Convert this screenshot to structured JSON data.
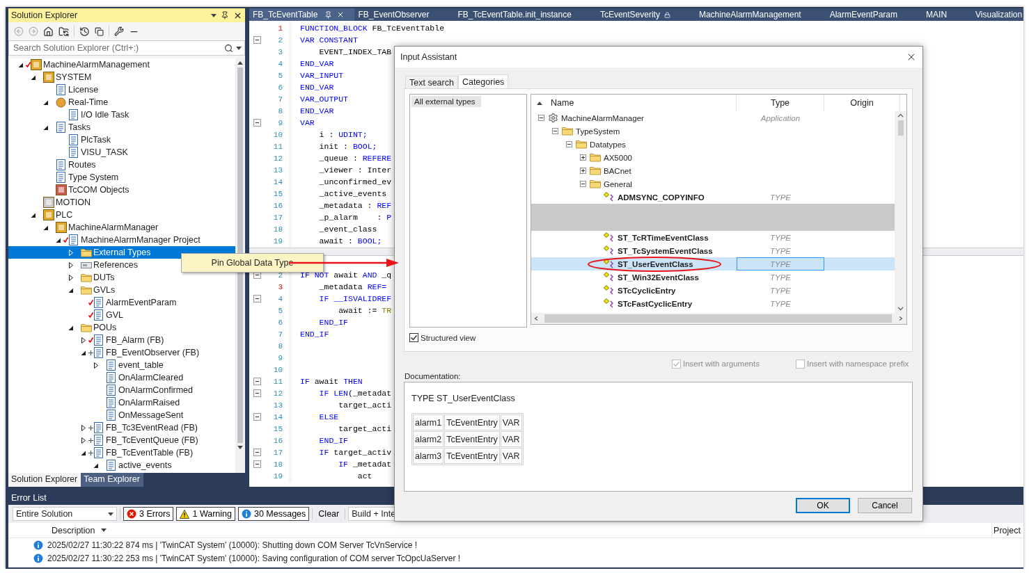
{
  "explorer": {
    "title": "Solution Explorer",
    "search": {
      "placeholder": "Search Solution Explorer (Ctrl+:)"
    },
    "tree": [
      {
        "label": "MachineAlarmManagement",
        "kind": "package",
        "checked_in": true,
        "expanded": true,
        "selected": false,
        "children": [
          {
            "label": "SYSTEM",
            "kind": "package",
            "expanded": true,
            "selected": false,
            "children": [
              {
                "label": "License",
                "kind": "document",
                "selected": false
              },
              {
                "label": "Real-Time",
                "kind": "sphere",
                "expanded": true,
                "selected": false,
                "children": [
                  {
                    "label": "I/O Idle Task",
                    "kind": "document",
                    "selected": false
                  }
                ]
              },
              {
                "label": "Tasks",
                "kind": "document",
                "expanded": true,
                "selected": false,
                "children": [
                  {
                    "label": "PlcTask",
                    "kind": "document",
                    "selected": false
                  },
                  {
                    "label": "VISU_TASK",
                    "kind": "document",
                    "selected": false
                  }
                ]
              },
              {
                "label": "Routes",
                "kind": "document",
                "selected": false
              },
              {
                "label": "Type System",
                "kind": "document",
                "selected": false
              },
              {
                "label": "TcCOM Objects",
                "kind": "component",
                "selected": false
              }
            ]
          },
          {
            "label": "MOTION",
            "kind": "motion",
            "selected": false
          },
          {
            "label": "PLC",
            "kind": "package",
            "expanded": true,
            "selected": false,
            "children": [
              {
                "label": "MachineAlarmManager",
                "kind": "package",
                "expanded": true,
                "selected": false,
                "children": [
                  {
                    "label": "MachineAlarmManager Project",
                    "kind": "document",
                    "checked_in": true,
                    "expanded": true,
                    "selected": false,
                    "children": [
                      {
                        "label": "External Types",
                        "kind": "folder",
                        "expanded": false,
                        "selected": true
                      },
                      {
                        "label": "References",
                        "kind": "drive",
                        "expanded": false,
                        "selected": false
                      },
                      {
                        "label": "DUTs",
                        "kind": "folder",
                        "expanded": false,
                        "selected": false
                      },
                      {
                        "label": "GVLs",
                        "kind": "folder",
                        "expanded": true,
                        "selected": false,
                        "children": [
                          {
                            "label": "AlarmEventParam",
                            "kind": "document",
                            "checked_in": true,
                            "selected": false
                          },
                          {
                            "label": "GVL",
                            "kind": "document",
                            "checked_in": true,
                            "selected": false
                          }
                        ]
                      },
                      {
                        "label": "POUs",
                        "kind": "folder",
                        "expanded": true,
                        "selected": false,
                        "children": [
                          {
                            "label": "FB_Alarm (FB)",
                            "kind": "document",
                            "checked_in": true,
                            "expanded": false,
                            "selected": false
                          },
                          {
                            "label": "FB_EventObserver (FB)",
                            "kind": "document",
                            "added": true,
                            "expanded": true,
                            "selected": false,
                            "children": [
                              {
                                "label": "event_table",
                                "kind": "document",
                                "expanded": false,
                                "selected": false
                              },
                              {
                                "label": "OnAlarmCleared",
                                "kind": "document",
                                "selected": false
                              },
                              {
                                "label": "OnAlarmConfirmed",
                                "kind": "document",
                                "selected": false
                              },
                              {
                                "label": "OnAlarmRaised",
                                "kind": "document",
                                "selected": false
                              },
                              {
                                "label": "OnMessageSent",
                                "kind": "document",
                                "selected": false
                              }
                            ]
                          },
                          {
                            "label": "FB_Tc3EventRead (FB)",
                            "kind": "document",
                            "added": true,
                            "expanded": false,
                            "selected": false
                          },
                          {
                            "label": "FB_TcEventQueue (FB)",
                            "kind": "document",
                            "added": true,
                            "expanded": false,
                            "selected": false
                          },
                          {
                            "label": "FB_TcEventTable (FB)",
                            "kind": "document",
                            "added": true,
                            "expanded": true,
                            "selected": false,
                            "children": [
                              {
                                "label": "active_events",
                                "kind": "document",
                                "expanded": true,
                                "selected": false
                              }
                            ]
                          }
                        ]
                      }
                    ]
                  }
                ]
              }
            ]
          }
        ]
      }
    ],
    "tabs": [
      {
        "label": "Solution Explorer",
        "selected": true
      },
      {
        "label": "Team Explorer",
        "selected": false
      }
    ]
  },
  "editor": {
    "tabs": [
      {
        "label": "FB_TcEventTable",
        "selected": true,
        "pinned": true,
        "locked": false
      },
      {
        "label": "FB_EventObserver",
        "selected": false,
        "pinned": false,
        "locked": false
      },
      {
        "label": "FB_TcEventTable.init_instance",
        "selected": false,
        "pinned": false,
        "locked": false
      },
      {
        "label": "TcEventSeverity",
        "selected": false,
        "pinned": false,
        "locked": true
      },
      {
        "label": "MachineAlarmManagement",
        "selected": false,
        "pinned": false,
        "locked": false
      },
      {
        "label": "AlarmEventParam",
        "selected": false,
        "pinned": false,
        "locked": false
      },
      {
        "label": "MAIN",
        "selected": false,
        "pinned": false,
        "locked": false
      },
      {
        "label": "Visualization",
        "selected": false,
        "pinned": false,
        "locked": false
      }
    ],
    "panes": [
      {
        "lines": [
          {
            "num": "1",
            "changed": true,
            "fold": false,
            "tokens": [
              {
                "text": "FUNCTION_BLOCK",
                "kind": "keyword"
              },
              {
                "text": " FB_TcEventTable",
                "kind": "plain"
              }
            ]
          },
          {
            "num": "2",
            "changed": false,
            "fold": true,
            "tokens": [
              {
                "text": "VAR CONSTANT",
                "kind": "keyword"
              }
            ]
          },
          {
            "num": "3",
            "changed": false,
            "fold": false,
            "tokens": [
              {
                "text": "    EVENT_INDEX_TAB",
                "kind": "plain"
              }
            ]
          },
          {
            "num": "4",
            "changed": false,
            "fold": false,
            "tokens": [
              {
                "text": "END_VAR",
                "kind": "keyword"
              }
            ]
          },
          {
            "num": "5",
            "changed": false,
            "fold": false,
            "tokens": [
              {
                "text": "VAR_INPUT",
                "kind": "keyword"
              }
            ]
          },
          {
            "num": "6",
            "changed": false,
            "fold": false,
            "tokens": [
              {
                "text": "END_VAR",
                "kind": "keyword"
              }
            ]
          },
          {
            "num": "7",
            "changed": false,
            "fold": false,
            "tokens": [
              {
                "text": "VAR_OUTPUT",
                "kind": "keyword"
              }
            ]
          },
          {
            "num": "8",
            "changed": false,
            "fold": false,
            "tokens": [
              {
                "text": "END_VAR",
                "kind": "keyword"
              }
            ]
          },
          {
            "num": "9",
            "changed": false,
            "fold": true,
            "tokens": [
              {
                "text": "VAR",
                "kind": "keyword"
              }
            ]
          },
          {
            "num": "10",
            "changed": false,
            "fold": false,
            "tokens": [
              {
                "text": "    i : ",
                "kind": "plain"
              },
              {
                "text": "UDINT;",
                "kind": "keyword"
              }
            ]
          },
          {
            "num": "11",
            "changed": false,
            "fold": false,
            "tokens": [
              {
                "text": "    init : ",
                "kind": "plain"
              },
              {
                "text": "BOOL;",
                "kind": "keyword"
              }
            ]
          },
          {
            "num": "12",
            "changed": false,
            "fold": false,
            "tokens": [
              {
                "text": "    _queue : ",
                "kind": "plain"
              },
              {
                "text": "REFERE",
                "kind": "keyword"
              }
            ]
          },
          {
            "num": "13",
            "changed": false,
            "fold": false,
            "tokens": [
              {
                "text": "    _viewer : Inter",
                "kind": "plain"
              }
            ]
          },
          {
            "num": "14",
            "changed": false,
            "fold": false,
            "tokens": [
              {
                "text": "    _unconfirmed_ev",
                "kind": "plain"
              }
            ]
          },
          {
            "num": "15",
            "changed": false,
            "fold": false,
            "tokens": [
              {
                "text": "    _active_events",
                "kind": "plain"
              }
            ]
          },
          {
            "num": "16",
            "changed": false,
            "fold": false,
            "tokens": [
              {
                "text": "    _metadata : ",
                "kind": "plain"
              },
              {
                "text": "REF",
                "kind": "keyword"
              }
            ]
          },
          {
            "num": "17",
            "changed": false,
            "fold": false,
            "tokens": [
              {
                "text": "    _p_alarm    : ",
                "kind": "plain"
              },
              {
                "text": "P",
                "kind": "keyword"
              }
            ]
          },
          {
            "num": "18",
            "changed": false,
            "fold": false,
            "tokens": [
              {
                "text": "    _event_class",
                "kind": "plain"
              }
            ]
          },
          {
            "num": "19",
            "changed": false,
            "fold": false,
            "tokens": [
              {
                "text": "    await : ",
                "kind": "plain"
              },
              {
                "text": "BOOL;",
                "kind": "keyword"
              }
            ]
          }
        ]
      },
      {
        "lines": [
          {
            "num": "2",
            "changed": false,
            "fold": true,
            "tokens": [
              {
                "text": "IF NOT",
                "kind": "keyword"
              },
              {
                "text": " await ",
                "kind": "plain"
              },
              {
                "text": "AND",
                "kind": "keyword"
              },
              {
                "text": " _q",
                "kind": "plain"
              }
            ]
          },
          {
            "num": "3",
            "changed": true,
            "fold": false,
            "tokens": [
              {
                "text": "    _metadata ",
                "kind": "plain"
              },
              {
                "text": "REF=",
                "kind": "keyword"
              }
            ]
          },
          {
            "num": "4",
            "changed": false,
            "fold": true,
            "tokens": [
              {
                "text": "    IF __ISVALIDREF",
                "kind": "keyword"
              }
            ]
          },
          {
            "num": "5",
            "changed": false,
            "fold": false,
            "tokens": [
              {
                "text": "        await := ",
                "kind": "plain"
              },
              {
                "text": "TR",
                "kind": "constant"
              }
            ]
          },
          {
            "num": "6",
            "changed": false,
            "fold": false,
            "tokens": [
              {
                "text": "    END_IF",
                "kind": "keyword"
              }
            ]
          },
          {
            "num": "7",
            "changed": false,
            "fold": false,
            "tokens": [
              {
                "text": "END_IF",
                "kind": "keyword"
              }
            ]
          },
          {
            "num": "8",
            "changed": false,
            "fold": false
          },
          {
            "num": "9",
            "changed": false,
            "fold": false
          },
          {
            "num": "10",
            "changed": false,
            "fold": false
          },
          {
            "num": "11",
            "changed": false,
            "fold": true,
            "tokens": [
              {
                "text": "IF",
                "kind": "keyword"
              },
              {
                "text": " await ",
                "kind": "plain"
              },
              {
                "text": "THEN",
                "kind": "keyword"
              }
            ]
          },
          {
            "num": "12",
            "changed": false,
            "fold": true,
            "tokens": [
              {
                "text": "    IF LEN",
                "kind": "keyword"
              },
              {
                "text": "(_metadat",
                "kind": "plain"
              }
            ]
          },
          {
            "num": "13",
            "changed": false,
            "fold": false,
            "tokens": [
              {
                "text": "        target_acti",
                "kind": "plain"
              }
            ]
          },
          {
            "num": "14",
            "changed": false,
            "fold": true,
            "tokens": [
              {
                "text": "    ELSE",
                "kind": "keyword"
              }
            ]
          },
          {
            "num": "15",
            "changed": false,
            "fold": false,
            "tokens": [
              {
                "text": "        target_acti",
                "kind": "plain"
              }
            ]
          },
          {
            "num": "16",
            "changed": false,
            "fold": false,
            "tokens": [
              {
                "text": "    END_IF",
                "kind": "keyword"
              }
            ]
          },
          {
            "num": "17",
            "changed": false,
            "fold": true,
            "tokens": [
              {
                "text": "    IF",
                "kind": "keyword"
              },
              {
                "text": " target_activ",
                "kind": "plain"
              }
            ]
          },
          {
            "num": "18",
            "changed": false,
            "fold": true,
            "tokens": [
              {
                "text": "        IF",
                "kind": "keyword"
              },
              {
                "text": " _metadat",
                "kind": "plain"
              }
            ]
          },
          {
            "num": "19",
            "changed": false,
            "fold": false,
            "tokens": [
              {
                "text": "            act",
                "kind": "plain"
              }
            ]
          }
        ]
      }
    ]
  },
  "tooltip": {
    "text": "Pin Global Data Type"
  },
  "dialog": {
    "title": "Input Assistant",
    "tabs": [
      {
        "label": "Text search",
        "selected": false
      },
      {
        "label": "Categories",
        "selected": true
      }
    ],
    "categories": [
      {
        "label": "All external types",
        "selected": true
      }
    ],
    "columns": [
      "Name",
      "Type",
      "Origin"
    ],
    "tree": [
      {
        "name": "MachineAlarmManager",
        "kind": "application",
        "type": "Application",
        "expanded": true,
        "selected": false,
        "children": [
          {
            "name": "TypeSystem",
            "kind": "folder",
            "expanded": true,
            "selected": false,
            "children": [
              {
                "name": "Datatypes",
                "kind": "folder",
                "expanded": true,
                "selected": false,
                "children": [
                  {
                    "name": "AX5000",
                    "kind": "folder",
                    "expanded": false,
                    "selected": false
                  },
                  {
                    "name": "BACnet",
                    "kind": "folder",
                    "expanded": false,
                    "selected": false
                  },
                  {
                    "name": "General",
                    "kind": "folder",
                    "expanded": true,
                    "selected": false,
                    "children": [
                      {
                        "name": "ADMSYNC_COPYINFO",
                        "kind": "datatype",
                        "type": "TYPE",
                        "selected": false
                      },
                      {
                        "kind": "redacted"
                      },
                      {
                        "name": "ST_TcRTimeEventClass",
                        "kind": "datatype",
                        "type": "TYPE",
                        "selected": false
                      },
                      {
                        "name": "ST_TcSystemEventClass",
                        "kind": "datatype",
                        "type": "TYPE",
                        "selected": false
                      },
                      {
                        "name": "ST_UserEventClass",
                        "kind": "datatype",
                        "type": "TYPE",
                        "selected": true
                      },
                      {
                        "name": "ST_Win32EventClass",
                        "kind": "datatype",
                        "type": "TYPE",
                        "selected": false
                      },
                      {
                        "name": "STcCyclicEntry",
                        "kind": "datatype",
                        "type": "TYPE",
                        "selected": false
                      },
                      {
                        "name": "STcFastCyclicEntry",
                        "kind": "datatype",
                        "type": "TYPE",
                        "selected": false
                      }
                    ]
                  }
                ]
              }
            ]
          }
        ]
      }
    ],
    "structured_view": {
      "label": "Structured view",
      "checked": true
    },
    "options": [
      {
        "label": "Insert with arguments",
        "checked": true,
        "disabled": true
      },
      {
        "label": "Insert with namespace prefix",
        "checked": false,
        "disabled": true
      }
    ],
    "documentation": {
      "label": "Documentation:",
      "heading": "TYPE ST_UserEventClass",
      "rows": [
        [
          "alarm1",
          "TcEventEntry",
          "VAR"
        ],
        [
          "alarm2",
          "TcEventEntry",
          "VAR"
        ],
        [
          "alarm3",
          "TcEventEntry",
          "VAR"
        ]
      ]
    },
    "buttons": [
      {
        "label": "OK",
        "default": true
      },
      {
        "label": "Cancel",
        "default": false
      }
    ]
  },
  "error_list": {
    "title": "Error List",
    "scope": "Entire Solution",
    "filters": [
      {
        "label": "3 Errors",
        "kind": "error",
        "selected": true
      },
      {
        "label": "1 Warning",
        "kind": "warning",
        "selected": true
      },
      {
        "label": "30 Messages",
        "kind": "info",
        "selected": true
      }
    ],
    "clear": "Clear",
    "build": "Build + Inte",
    "columns": [
      "Description",
      "Project"
    ],
    "rows": [
      {
        "kind": "info",
        "text": "2025/02/27 11:30:22 874 ms | 'TwinCAT System' (10000): Shutting down COM Server TcVnService !"
      },
      {
        "kind": "info",
        "text": "2025/02/27 11:30:22 253 ms | 'TwinCAT System' (10000): Saving configuration of COM server TcOpcUaServer !"
      }
    ]
  }
}
